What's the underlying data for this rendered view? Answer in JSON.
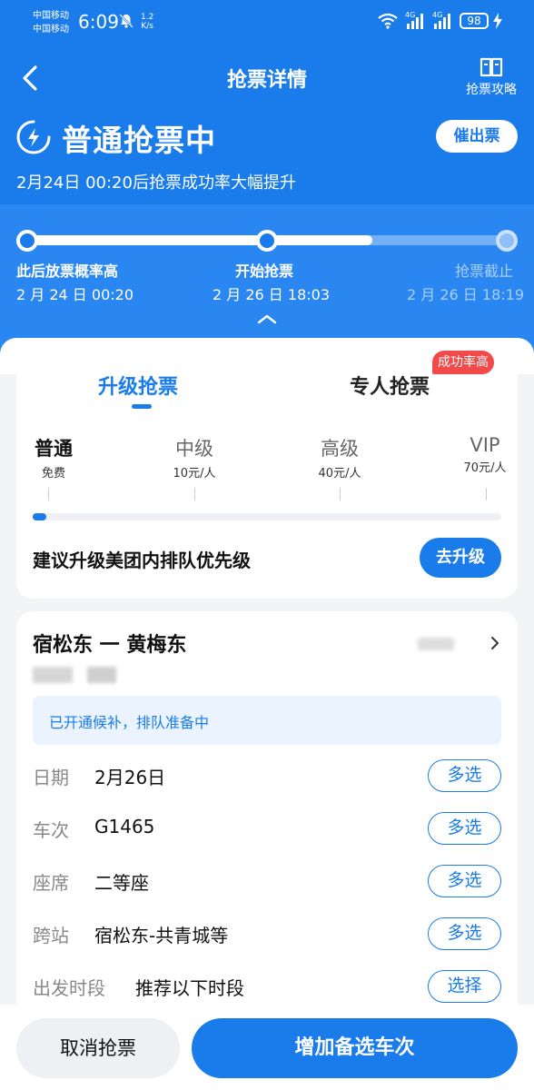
{
  "status_bar": {
    "carrier_1": "中国移动",
    "carrier_2": "中国移动",
    "time": "6:09",
    "speed_value": "1.2",
    "speed_unit": "K/s",
    "net_1": "4G",
    "net_2": "4G",
    "battery": "98"
  },
  "nav": {
    "title": "抢票详情",
    "guide_label": "抢票攻略"
  },
  "header": {
    "status_title": "普通抢票中",
    "urge_label": "催出票",
    "subtitle": "2月24日 00:20后抢票成功率大幅提升"
  },
  "timeline": {
    "progress": 0.72,
    "steps": [
      {
        "label": "此后放票概率高",
        "time": "2 月 24 日 00:20"
      },
      {
        "label": "开始抢票",
        "time": "2 月 26 日 18:03"
      },
      {
        "label": "抢票截止",
        "time": "2 月 26 日 18:19"
      }
    ]
  },
  "tabs": {
    "upgrade": "升级抢票",
    "dedicated": "专人抢票",
    "badge": "成功率高"
  },
  "tiers": [
    {
      "name": "普通",
      "price": "免费"
    },
    {
      "name": "中级",
      "price": "10元/人"
    },
    {
      "name": "高级",
      "price": "40元/人"
    },
    {
      "name": "VIP",
      "price": "70元/人"
    }
  ],
  "tier_level": 0.03,
  "upgrade": {
    "text": "建议升级美团内排队优先级",
    "button": "去升级"
  },
  "order": {
    "route": "宿松东 一 黄梅东",
    "notice": "已开通候补，排队准备中",
    "rows": [
      {
        "label": "日期",
        "value": "2月26日",
        "action": "多选"
      },
      {
        "label": "车次",
        "value": "G1465",
        "action": "多选"
      },
      {
        "label": "座席",
        "value": "二等座",
        "action": "多选"
      },
      {
        "label": "跨站",
        "value": "宿松东-共青城等",
        "action": "多选"
      },
      {
        "label": "出发时段",
        "value": "推荐以下时段",
        "action": "选择"
      }
    ]
  },
  "bottom": {
    "cancel": "取消抢票",
    "add": "增加备选车次"
  },
  "colors": {
    "primary": "#1a7bea",
    "badge": "#f24a4a"
  }
}
